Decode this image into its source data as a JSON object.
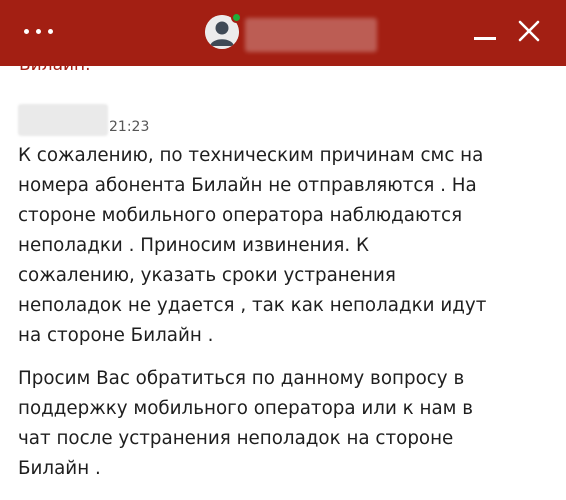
{
  "header": {
    "menu_icon": "more-horizontal-icon",
    "avatar_icon": "user-avatar-icon",
    "status_color": "#1fae3a",
    "background_color": "#a31f13",
    "minimize_icon": "minimize-icon",
    "close_icon": "close-icon"
  },
  "previous_message": {
    "text": "Билайн."
  },
  "message": {
    "time": "21:23",
    "paragraph_1": [
      "К сожалению, по техническим причинам смс на",
      "номера абонента Билайн не отправляются . На",
      "стороне мобильного оператора наблюдаются",
      "неполадки . Приносим извинения. К",
      "сожалению, указать сроки устранения",
      "неполадок не удается , так как неполадки идут",
      "на стороне Билайн ."
    ],
    "paragraph_2": [
      "Просим Вас обратиться по данному вопросу в",
      "поддержку мобильного оператора или к нам в",
      "чат после устранения неполадок на стороне",
      "Билайн ."
    ]
  }
}
